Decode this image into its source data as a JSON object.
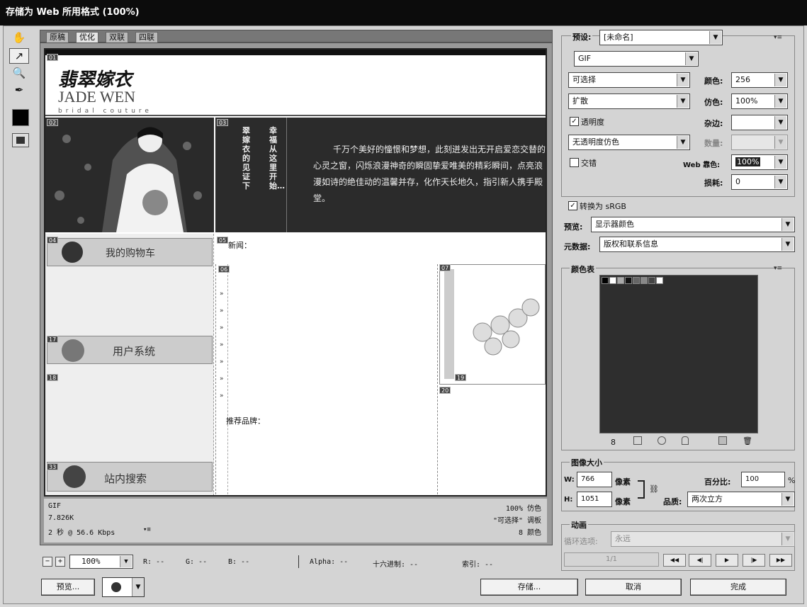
{
  "title": "存储为 Web 所用格式 (100%)",
  "tabs": [
    "原稿",
    "优化",
    "双联",
    "四联"
  ],
  "tools": {
    "hand": "hand-icon",
    "slice_select": "slice-select-icon",
    "zoom": "zoom-icon",
    "eyedropper": "eyedropper-icon",
    "color": "#000000",
    "toggle": "slice-visibility-icon"
  },
  "doc": {
    "logo_cn": "翡翠嫁衣",
    "logo_en": "JADE WEN",
    "logo_sub": "bridal couture",
    "vert1": "翠嫁衣的见证下",
    "vert2": "幸福从这里开始…",
    "intro": "千万个美好的憧憬和梦想，此刻迸发出无开启爱恋交替的心灵之窗，闪烁浪漫神奇的瞬固挚爱唯美的精彩瞬间，点亮浪漫如诗的绝佳动的温馨并存，化作天长地久，指引新人携手殿堂。",
    "news": "新闻：",
    "brand": "推荐品牌：",
    "cart": "我的购物车",
    "user": "用户系统",
    "search": "站内搜索",
    "slices": [
      "01",
      "02",
      "03",
      "04",
      "05",
      "06",
      "07",
      "17",
      "18",
      "19",
      "20",
      "33"
    ]
  },
  "status": {
    "format": "GIF",
    "size": "7.826K",
    "time": "2 秒 @ 56.6 Kbps",
    "dither": "100% 仿色",
    "palette": "\"可选择\" 调板",
    "colors": "8 颜色"
  },
  "bottombar": {
    "zoom": "100%",
    "r": "R: --",
    "g": "G: --",
    "b": "B: --",
    "alpha": "Alpha: --",
    "hex": "十六进制: --",
    "index": "索引: --"
  },
  "buttons": {
    "preview": "预览...",
    "save": "存储...",
    "cancel": "取消",
    "done": "完成"
  },
  "settings": {
    "preset_label": "预设:",
    "preset": "[未命名]",
    "format": "GIF",
    "reduction": "可选择",
    "colors_label": "颜色:",
    "colors": "256",
    "dither_algo": "扩散",
    "dither_label": "仿色:",
    "dither": "100%",
    "transparency": "透明度",
    "matte_label": "杂边:",
    "trans_dither": "无透明度仿色",
    "amount_label": "数量:",
    "interlaced": "交错",
    "websnap_label": "Web 靠色:",
    "websnap": "100%",
    "lossy_label": "损耗:",
    "lossy": "0",
    "srgb": "转换为 sRGB",
    "preview_label": "预览:",
    "preview_val": "显示器颜色",
    "meta_label": "元数据:",
    "meta": "版权和联系信息"
  },
  "colortable": {
    "title": "颜色表",
    "count": "8",
    "swatches": [
      "#000000",
      "#ffffff",
      "#aaaaaa",
      "#111111",
      "#666666",
      "#888888",
      "#444444",
      "#ffffff"
    ]
  },
  "imagesize": {
    "title": "图像大小",
    "w_label": "W:",
    "w": "766",
    "h_label": "H:",
    "h": "1051",
    "unit": "像素",
    "pct_label": "百分比:",
    "pct": "100",
    "pct_unit": "%",
    "quality_label": "品质:",
    "quality": "两次立方"
  },
  "animation": {
    "title": "动画",
    "loop_label": "循环选项:",
    "loop": "永远",
    "frame": "1/1"
  }
}
